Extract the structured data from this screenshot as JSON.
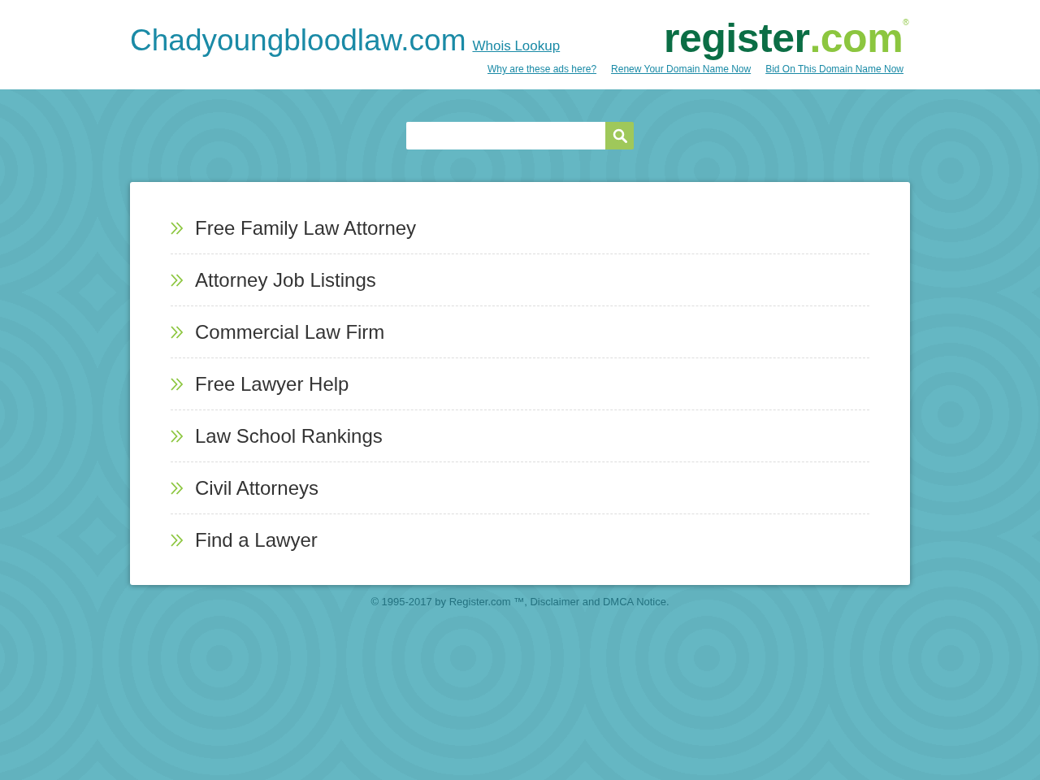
{
  "header": {
    "domain": "Chadyoungbloodlaw.com",
    "whois_link": "Whois Lookup",
    "logo": {
      "name": "register",
      "suffix": ".com",
      "mark": "®"
    },
    "links": [
      "Why are these ads here?",
      "Renew Your Domain Name Now",
      "Bid On This Domain Name Now"
    ]
  },
  "links": [
    "Free Family Law Attorney",
    "Attorney Job Listings",
    "Commercial Law Firm",
    "Free Lawyer Help",
    "Law School Rankings",
    "Civil Attorneys",
    "Find a Lawyer"
  ],
  "footer": "© 1995-2017 by Register.com ™, Disclaimer and DMCA Notice."
}
